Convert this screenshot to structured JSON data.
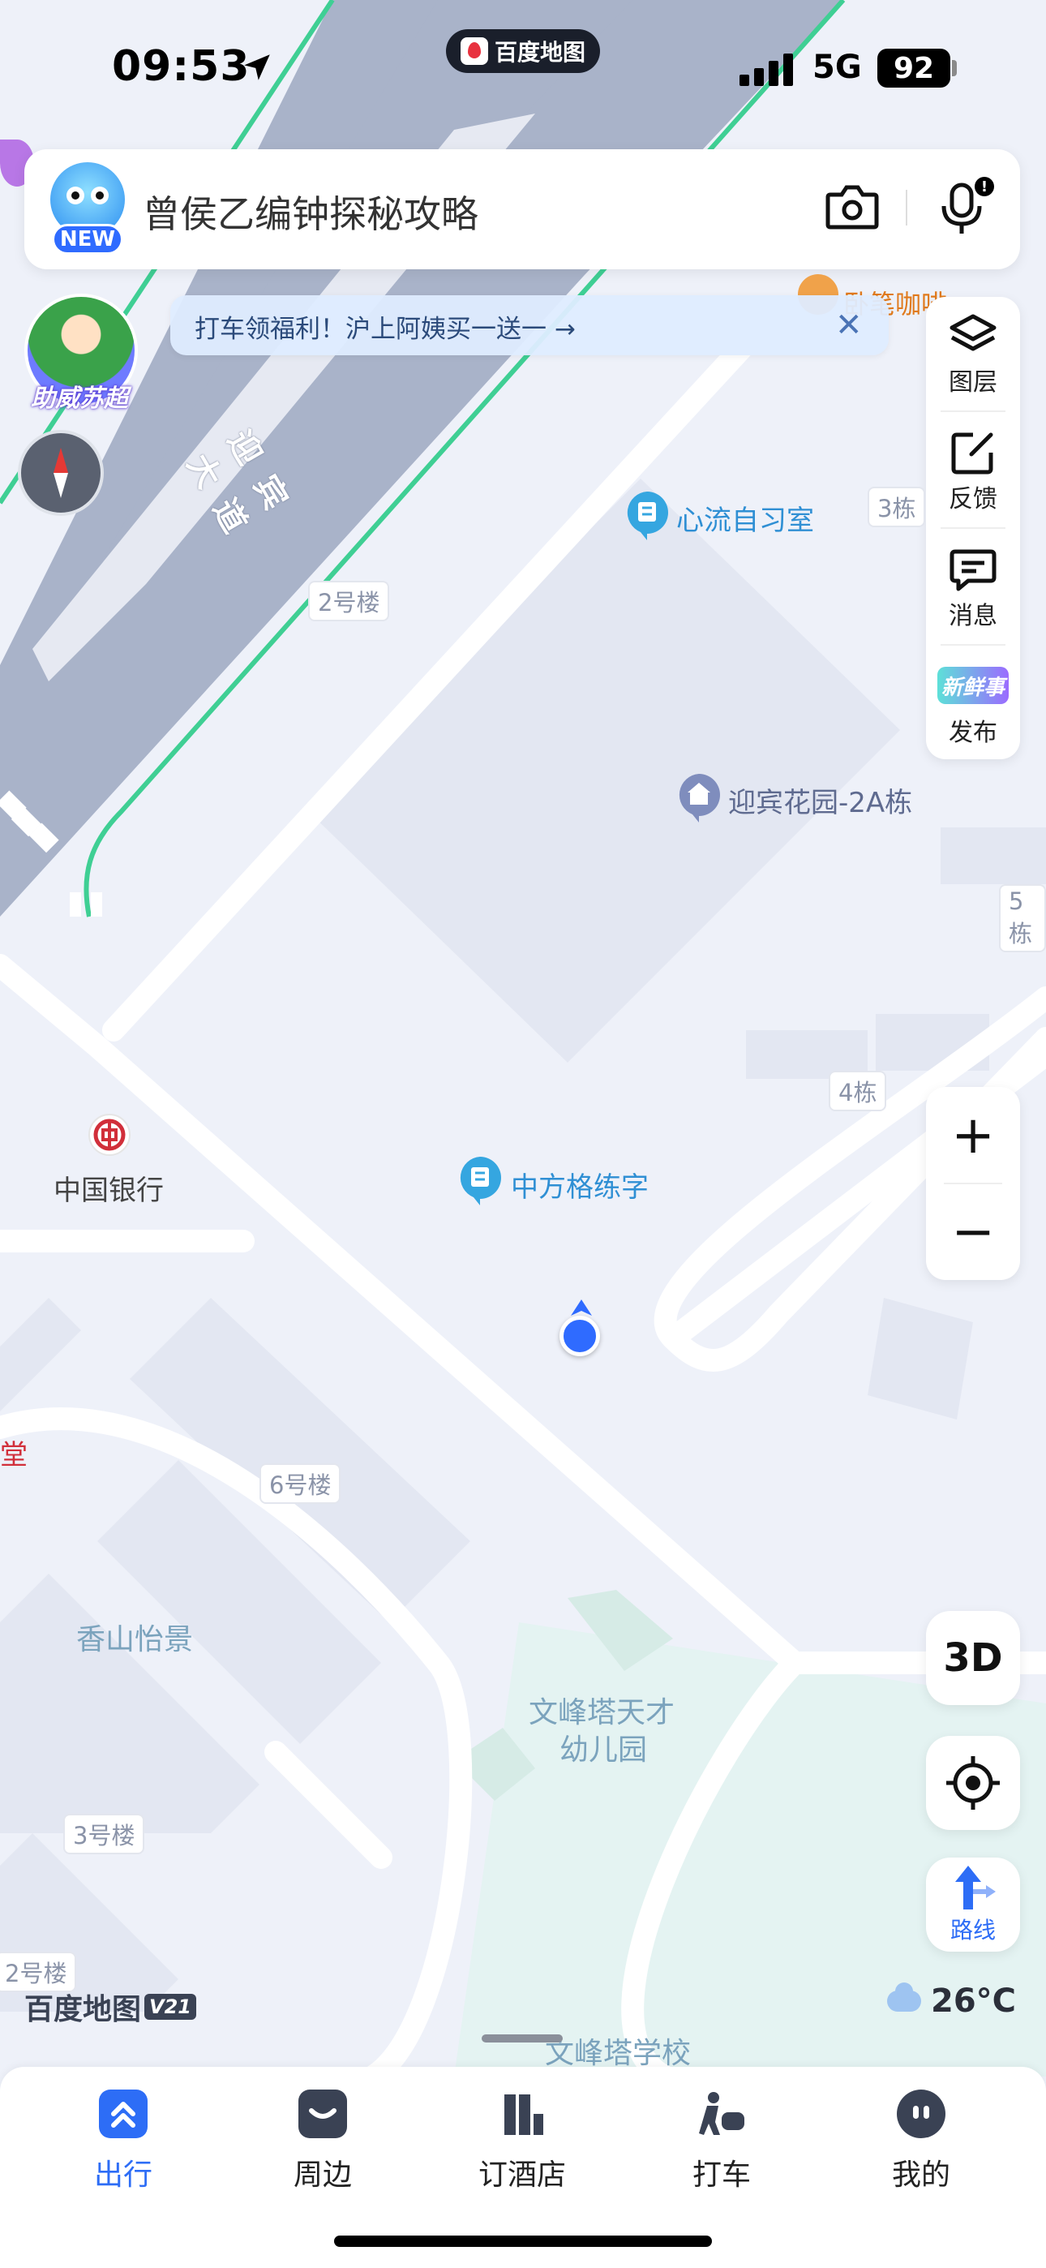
{
  "status_bar": {
    "time": "09:53",
    "network": "5G",
    "battery": "92"
  },
  "app_pill": {
    "label": "百度地图"
  },
  "search": {
    "placeholder": "曾侯乙编钟探秘攻略",
    "mascot_badge": "NEW"
  },
  "banner": {
    "text": "打车领福利！沪上阿姨买一送一 →"
  },
  "promo": {
    "label": "助威苏超"
  },
  "right_toolbar": [
    {
      "label": "图层",
      "icon": "layers-icon"
    },
    {
      "label": "反馈",
      "icon": "edit-icon"
    },
    {
      "label": "消息",
      "icon": "message-icon"
    },
    {
      "label": "发布",
      "icon": "publish-icon",
      "badge": "新鲜事"
    }
  ],
  "zoom": {
    "in": "+",
    "out": "−"
  },
  "map_buttons": {
    "three_d": "3D",
    "route": "路线"
  },
  "map": {
    "road_name": "迎宾大道",
    "pois": {
      "study_room": "心流自习室",
      "residence": "迎宾花园-2A栋",
      "calligraphy": "中方格练字",
      "bank": "中国银行",
      "cafe": "卧笔咖啡",
      "kindergarten_1": "文峰塔天才",
      "kindergarten_2": "幼儿园",
      "community": "香山怡景",
      "school": "文峰塔学校",
      "hall": "堂"
    },
    "buildings": {
      "b2": "2号楼",
      "d3": "3栋",
      "d5": "5栋",
      "d4": "4栋",
      "b6": "6号楼",
      "b3": "3号楼",
      "b2b": "2号楼"
    }
  },
  "watermark": {
    "brand": "百度地图",
    "version": "V21"
  },
  "weather": {
    "temperature": "26°C"
  },
  "bottom_nav": [
    {
      "label": "出行",
      "active": true,
      "color": "#2d6df6"
    },
    {
      "label": "周边",
      "active": false
    },
    {
      "label": "订酒店",
      "active": false
    },
    {
      "label": "打车",
      "active": false
    },
    {
      "label": "我的",
      "active": false
    }
  ],
  "colors": {
    "accent": "#2d6df6",
    "road": "#a9b3c9",
    "road_edge": "#3fcf94",
    "map_bg": "#eef1f9",
    "location_dot": "#2f6bff"
  }
}
